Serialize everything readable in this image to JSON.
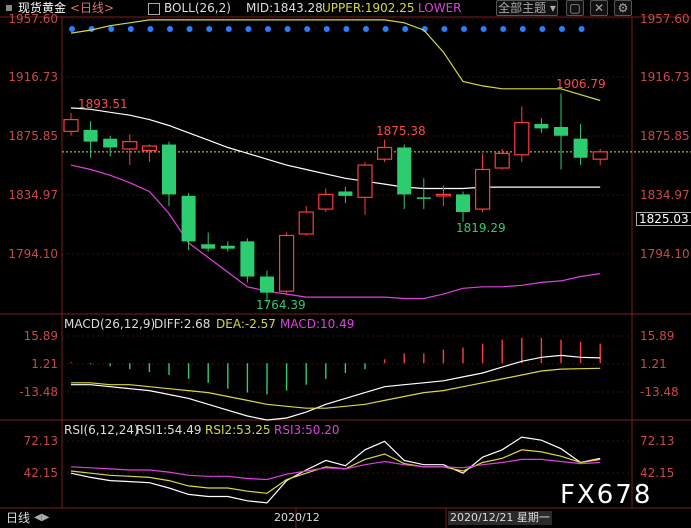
{
  "header": {
    "symbol": "现货黄金",
    "period": "<日线>",
    "boll_label": "BOLL(26,2)",
    "mid_label": "MID:1843.28",
    "upper_label": "UPPER:1902.25",
    "lower_label": "LOWER",
    "theme_button": "全部主题",
    "icons": [
      "chevron-down-icon",
      "window-icon",
      "close-icon"
    ]
  },
  "price_axis": {
    "left": [
      "1957.60",
      "1916.73",
      "1875.85",
      "1834.97",
      "1794.10"
    ],
    "right": [
      "1957.60",
      "1916.73",
      "1875.85",
      "1834.97",
      "1794.10"
    ],
    "current": "1825.03"
  },
  "annotations": {
    "a1": "1893.51",
    "a2": "1875.38",
    "a3": "1906.79",
    "a4": "1819.29",
    "a5": "1764.39"
  },
  "macd": {
    "title": "MACD(26,12,9)",
    "diff": "DIFF:2.68",
    "dea": "DEA:-2.57",
    "macd": "MACD:10.49",
    "axis_left": [
      "15.89",
      "1.21",
      "-13.48"
    ],
    "axis_right": [
      "15.89",
      "1.21",
      "-13.48"
    ]
  },
  "rsi": {
    "title": "RSI(6,12,24)",
    "rsi1": "RSI1:54.49",
    "rsi2": "RSI2:53.25",
    "rsi3": "RSI3:50.20",
    "axis_left": [
      "72.13",
      "42.15"
    ],
    "axis_right": [
      "72.13",
      "42.15"
    ]
  },
  "footer": {
    "period": "日线",
    "month": "2020/12",
    "date": "2020/12/21 星期一"
  },
  "watermark": "FX678",
  "colors": {
    "up": "#ff3c3c",
    "down": "#2ecc71",
    "mid": "#ffffff",
    "upper": "#d8d840",
    "lower": "#e040e0",
    "axis": "#c84848"
  },
  "chart_data": {
    "type": "candlestick",
    "candles": [
      {
        "open": 1881,
        "high": 1893.5,
        "low": 1878,
        "close": 1889,
        "dir": "up"
      },
      {
        "open": 1882,
        "high": 1888,
        "low": 1863,
        "close": 1874,
        "dir": "down"
      },
      {
        "open": 1876,
        "high": 1878,
        "low": 1864,
        "close": 1870,
        "dir": "down"
      },
      {
        "open": 1869,
        "high": 1879,
        "low": 1858,
        "close": 1874,
        "dir": "up"
      },
      {
        "open": 1871,
        "high": 1872,
        "low": 1860,
        "close": 1868,
        "dir": "up"
      },
      {
        "open": 1872,
        "high": 1874,
        "low": 1830,
        "close": 1838,
        "dir": "down"
      },
      {
        "open": 1837,
        "high": 1839,
        "low": 1800,
        "close": 1806,
        "dir": "down"
      },
      {
        "open": 1804,
        "high": 1812,
        "low": 1799,
        "close": 1801,
        "dir": "down"
      },
      {
        "open": 1803,
        "high": 1806,
        "low": 1799,
        "close": 1801,
        "dir": "down"
      },
      {
        "open": 1806,
        "high": 1808,
        "low": 1778,
        "close": 1782,
        "dir": "down"
      },
      {
        "open": 1782,
        "high": 1786,
        "low": 1764.4,
        "close": 1771,
        "dir": "down"
      },
      {
        "open": 1772,
        "high": 1812,
        "low": 1770,
        "close": 1810,
        "dir": "up"
      },
      {
        "open": 1811,
        "high": 1830,
        "low": 1810,
        "close": 1826,
        "dir": "up"
      },
      {
        "open": 1828,
        "high": 1842,
        "low": 1826,
        "close": 1838,
        "dir": "up"
      },
      {
        "open": 1837,
        "high": 1843,
        "low": 1832,
        "close": 1840,
        "dir": "down"
      },
      {
        "open": 1836,
        "high": 1860,
        "low": 1824,
        "close": 1858,
        "dir": "up"
      },
      {
        "open": 1862,
        "high": 1875.4,
        "low": 1860,
        "close": 1870,
        "dir": "up"
      },
      {
        "open": 1870,
        "high": 1872,
        "low": 1828,
        "close": 1838,
        "dir": "down"
      },
      {
        "open": 1836,
        "high": 1849,
        "low": 1828,
        "close": 1836,
        "dir": "down"
      },
      {
        "open": 1838,
        "high": 1844,
        "low": 1830,
        "close": 1838,
        "dir": "up"
      },
      {
        "open": 1838,
        "high": 1840,
        "low": 1819.3,
        "close": 1826,
        "dir": "down"
      },
      {
        "open": 1828,
        "high": 1866,
        "low": 1826,
        "close": 1855,
        "dir": "up"
      },
      {
        "open": 1856,
        "high": 1869,
        "low": 1855,
        "close": 1866,
        "dir": "up"
      },
      {
        "open": 1865,
        "high": 1898,
        "low": 1860,
        "close": 1887,
        "dir": "up"
      },
      {
        "open": 1883,
        "high": 1890,
        "low": 1880,
        "close": 1886,
        "dir": "down"
      },
      {
        "open": 1884,
        "high": 1906.8,
        "low": 1855,
        "close": 1878,
        "dir": "down"
      },
      {
        "open": 1876,
        "high": 1886,
        "low": 1858,
        "close": 1863,
        "dir": "down"
      },
      {
        "open": 1862,
        "high": 1869,
        "low": 1858,
        "close": 1867,
        "dir": "up"
      }
    ],
    "boll_mid": [
      1897,
      1896,
      1894,
      1892,
      1889,
      1885,
      1880,
      1875,
      1870,
      1866,
      1862,
      1858,
      1855,
      1852,
      1849,
      1847,
      1845,
      1843,
      1842,
      1842,
      1842,
      1843,
      1843,
      1843,
      1843,
      1843,
      1843,
      1843
    ],
    "boll_upper": [
      1948,
      1950,
      1953,
      1955,
      1957,
      1957,
      1957,
      1957,
      1957,
      1957,
      1957,
      1957,
      1957,
      1957,
      1957,
      1957,
      1957,
      1955,
      1950,
      1935,
      1915,
      1912,
      1910,
      1910,
      1910,
      1910,
      1906,
      1902
    ],
    "boll_lower": [
      1858,
      1855,
      1851,
      1846,
      1840,
      1825,
      1805,
      1795,
      1785,
      1775,
      1772,
      1770,
      1768,
      1768,
      1768,
      1768,
      1768,
      1767,
      1767,
      1770,
      1774,
      1775,
      1775,
      1776,
      1778,
      1779,
      1782,
      1784
    ],
    "macd_hist": [
      0.5,
      -0.5,
      -1.5,
      -3,
      -4.5,
      -6,
      -8,
      -10,
      -13,
      -15,
      -16,
      -14,
      -11,
      -8,
      -5,
      -3,
      2,
      5,
      5,
      7,
      8,
      10,
      12,
      13,
      13,
      12,
      11,
      10
    ],
    "macd_diff": [
      -11,
      -11,
      -12,
      -13,
      -14,
      -16,
      -18,
      -21,
      -24,
      -27,
      -29,
      -28,
      -25,
      -21,
      -18,
      -15,
      -12,
      -11,
      -10,
      -9,
      -7,
      -5,
      -2,
      1,
      3,
      4,
      3,
      2.7
    ],
    "macd_dea": [
      -10,
      -10,
      -11,
      -11,
      -12,
      -13,
      -14,
      -15,
      -17,
      -19,
      -21,
      -22,
      -23,
      -23,
      -22,
      -21,
      -19,
      -17,
      -15,
      -14,
      -12,
      -10,
      -8,
      -6,
      -4,
      -3,
      -2.8,
      -2.6
    ],
    "rsi1": [
      40,
      36,
      33,
      32,
      31,
      26,
      20,
      18,
      18,
      14,
      12,
      33,
      43,
      52,
      47,
      62,
      70,
      52,
      48,
      48,
      40,
      55,
      62,
      74,
      71,
      63,
      50,
      54
    ],
    "rsi2": [
      42,
      40,
      38,
      37,
      36,
      33,
      28,
      26,
      26,
      23,
      21,
      34,
      40,
      46,
      44,
      53,
      58,
      49,
      46,
      46,
      42,
      50,
      54,
      62,
      60,
      56,
      50,
      53
    ],
    "rsi3": [
      46,
      45,
      44,
      43,
      43,
      41,
      38,
      37,
      37,
      35,
      34,
      39,
      42,
      45,
      44,
      48,
      51,
      48,
      46,
      46,
      45,
      48,
      50,
      53,
      53,
      51,
      49,
      50
    ],
    "price_range": [
      1766,
      1957.6
    ],
    "macd_range": [
      -28,
      18
    ],
    "rsi_range": [
      10,
      75
    ]
  }
}
